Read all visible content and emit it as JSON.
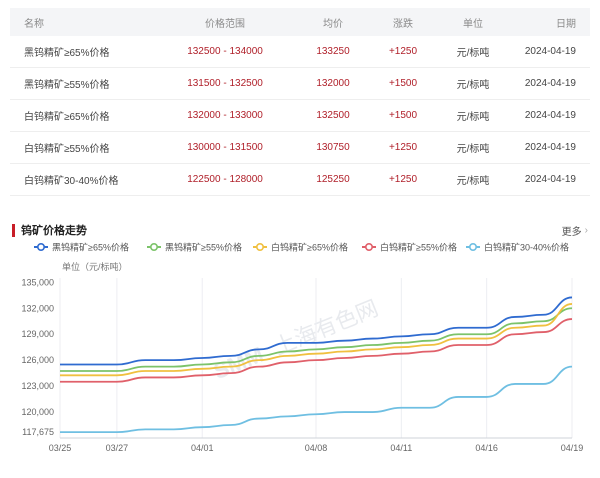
{
  "table": {
    "headers": {
      "name": "名称",
      "range": "价格范围",
      "avg": "均价",
      "change": "涨跌",
      "unit": "单位",
      "date": "日期"
    },
    "rows": [
      {
        "name": "黑钨精矿≥65%价格",
        "range": "132500 - 134000",
        "avg": "133250",
        "change": "+1250",
        "unit": "元/标吨",
        "date": "2024-04-19"
      },
      {
        "name": "黑钨精矿≥55%价格",
        "range": "131500 - 132500",
        "avg": "132000",
        "change": "+1500",
        "unit": "元/标吨",
        "date": "2024-04-19"
      },
      {
        "name": "白钨精矿≥65%价格",
        "range": "132000 - 133000",
        "avg": "132500",
        "change": "+1500",
        "unit": "元/标吨",
        "date": "2024-04-19"
      },
      {
        "name": "白钨精矿≥55%价格",
        "range": "130000 - 131500",
        "avg": "130750",
        "change": "+1250",
        "unit": "元/标吨",
        "date": "2024-04-19"
      },
      {
        "name": "白钨精矿30-40%价格",
        "range": "122500 - 128000",
        "avg": "125250",
        "change": "+1250",
        "unit": "元/标吨",
        "date": "2024-04-19"
      }
    ]
  },
  "chart_header": {
    "title": "钨矿价格走势",
    "more": "更多"
  },
  "chart_data": {
    "type": "line",
    "ylabel": "单位（元/标吨）",
    "ylim": [
      117000,
      135500
    ],
    "yticks": [
      117675,
      120000,
      123000,
      126000,
      129000,
      132000,
      135000
    ],
    "ytick_labels": [
      "117,675",
      "120,000",
      "123,000",
      "126,000",
      "129,000",
      "132,000",
      "135,000"
    ],
    "grid": false,
    "legend_position": "top",
    "x": [
      "03/25",
      "03/26",
      "03/27",
      "03/28",
      "03/29",
      "04/01",
      "04/02",
      "04/03",
      "04/07",
      "04/08",
      "04/09",
      "04/10",
      "04/11",
      "04/12",
      "04/15",
      "04/16",
      "04/17",
      "04/18",
      "04/19"
    ],
    "xtick_labels": [
      "03/25",
      "03/27",
      "04/01",
      "04/08",
      "04/11",
      "04/16",
      "04/19"
    ],
    "series": [
      {
        "name": "黑钨精矿≥65%价格",
        "color": "#2f6bd0",
        "values": [
          125500,
          125500,
          125500,
          126000,
          126000,
          126250,
          126500,
          127250,
          128000,
          128000,
          128250,
          128500,
          128750,
          129000,
          129750,
          129750,
          131000,
          131250,
          133250
        ]
      },
      {
        "name": "黑钨精矿≥55%价格",
        "color": "#7cc36a",
        "values": [
          124750,
          124750,
          124750,
          125250,
          125250,
          125500,
          125750,
          126500,
          127000,
          127250,
          127500,
          127750,
          128000,
          128250,
          129000,
          129000,
          130250,
          130500,
          132000
        ]
      },
      {
        "name": "白钨精矿≥65%价格",
        "color": "#f0c040",
        "values": [
          124250,
          124250,
          124250,
          124750,
          124750,
          125000,
          125250,
          126000,
          126500,
          126750,
          127000,
          127250,
          127500,
          127750,
          128500,
          128500,
          129750,
          130000,
          132500
        ]
      },
      {
        "name": "白钨精矿≥55%价格",
        "color": "#e0606a",
        "values": [
          123500,
          123500,
          123500,
          124000,
          124000,
          124250,
          124500,
          125250,
          125750,
          126000,
          126250,
          126500,
          126750,
          127000,
          127750,
          127750,
          129000,
          129250,
          130750
        ]
      },
      {
        "name": "白钨精矿30-40%价格",
        "color": "#6fbfe2",
        "values": [
          117675,
          117675,
          117675,
          118000,
          118000,
          118250,
          118500,
          119250,
          119500,
          119750,
          120000,
          120000,
          120500,
          120500,
          121750,
          121750,
          123250,
          123250,
          125250
        ]
      }
    ]
  },
  "watermark": {
    "brand": "SMM",
    "text": "上海有色网"
  }
}
